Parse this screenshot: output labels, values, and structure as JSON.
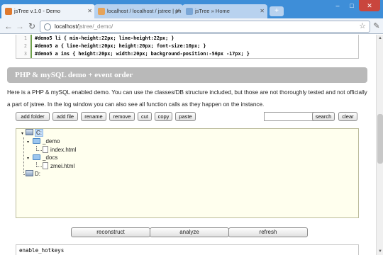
{
  "browser": {
    "tabs": [
      {
        "label": "jsTree v.1.0 - Demo",
        "active": true
      },
      {
        "label": "localhost / localhost / jstree | ph",
        "active": false
      },
      {
        "label": "jsTree » Home",
        "active": false
      }
    ],
    "new_tab": "+",
    "window_controls": {
      "minimize": "–",
      "maximize": "□",
      "close": "✕"
    },
    "url_host": "localhost/",
    "url_path": "jstree/_demo/",
    "icons": [
      "back-icon",
      "forward-icon",
      "reload-icon",
      "globe-icon",
      "star-icon",
      "wrench-icon"
    ]
  },
  "code": {
    "lines": [
      {
        "num": "1",
        "text": "#demo5 li { min-height:22px; line-height:22px; }"
      },
      {
        "num": "2",
        "text": "#demo5 a { line-height:20px; height:20px; font-size:10px; }"
      },
      {
        "num": "3",
        "text": "#demo5 a ins { height:20px; width:20px; background-position:-56px -17px; }"
      }
    ]
  },
  "section": {
    "title": "PHP & mySQL demo + event order"
  },
  "description": "Here is a PHP & mySQL enabled demo. You can use the classes/DB structure included, but those are not thoroughly tested and not officially a part of jstree. In the log window you can also see all function calls as they happen on the instance.",
  "actions": {
    "add_folder": "add folder",
    "add_file": "add file",
    "rename": "rename",
    "remove": "remove",
    "cut": "cut",
    "copy": "copy",
    "paste": "paste",
    "search": "search",
    "clear": "clear",
    "search_value": ""
  },
  "tree": {
    "c": "C:",
    "demo": "_demo",
    "index": "index.html",
    "docs": "_docs",
    "zmei": "zmei.html",
    "d": "D:"
  },
  "bottom": {
    "reconstruct": "reconstruct",
    "analyze": "analyze",
    "refresh": "refresh"
  },
  "log": {
    "first_line": "enable_hotkeys"
  },
  "colors": {
    "titlebar": "#3e8ed8",
    "tree_bg": "#ffffee",
    "section_bar": "#b9b9b9"
  }
}
